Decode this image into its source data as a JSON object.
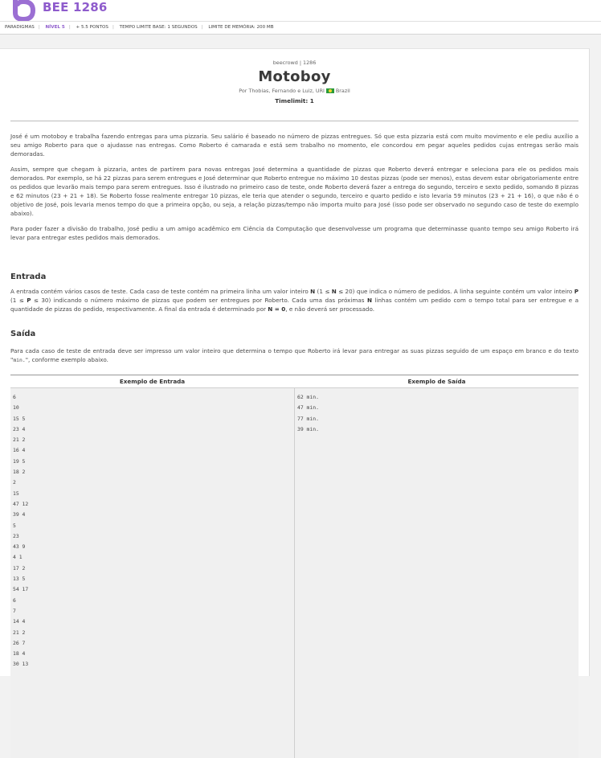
{
  "app": {
    "title": "BEE 1286",
    "brand_color": "#8e5bcc"
  },
  "meta": {
    "items": [
      "PARADIGMAS",
      "NÍVEL 5",
      "+ 5.5 PONTOS",
      "TEMPO LIMITE BASE: 1 SEGUNDOS",
      "LIMITE DE MEMÓRIA: 200 MB"
    ]
  },
  "problem": {
    "crumb": "beecrowd | 1286",
    "title": "Motoboy",
    "author": "Por Thobias, Fernando e Luiz, URI",
    "country": "Brazil",
    "timelimit": "Timelimit: 1"
  },
  "description": {
    "p1": "José é um motoboy e trabalha fazendo entregas para uma pizzaria. Seu salário é baseado no número de pizzas entregues. Só que esta pizzaria está com muito movimento e ele pediu auxílio a seu amigo Roberto para que o ajudasse nas entregas. Como Roberto é camarada e está sem trabalho no momento, ele concordou em pegar aqueles pedidos cujas entregas serão mais demoradas.",
    "p2": "Assim, sempre que chegam à pizzaria, antes de partirem para novas entregas José determina a quantidade de pizzas que Roberto deverá entregar e seleciona para ele os pedidos mais demorados. Por exemplo, se há 22 pizzas para serem entregues e José determinar que Roberto entregue no máximo 10 destas pizzas (pode ser menos), estas devem estar obrigatoriamente entre os pedidos que levarão mais tempo para serem entregues. Isso é ilustrado no primeiro caso de teste, onde Roberto deverá fazer a entrega do segundo, terceiro e sexto pedido, somando 8 pizzas e 62 minutos (23 + 21 + 18). Se Roberto fosse realmente entregar 10 pizzas, ele teria que atender o segundo, terceiro e quarto pedido e isto levaria 59 minutos (23 + 21 + 16), o que não é o objetivo de José, pois levaria menos tempo do que a primeira opção, ou seja, a relação pizzas/tempo não importa muito para José (isso pode ser observado no segundo caso de teste do exemplo abaixo).",
    "p3": "Para poder fazer a divisão do trabalho, José pediu a um amigo acadêmico em Ciência da Computação que desenvolvesse um programa que determinasse quanto tempo seu amigo Roberto irá levar para entregar estes pedidos mais demorados."
  },
  "input_section": {
    "heading": "Entrada",
    "t1": "A entrada contém vários casos de teste. Cada caso de teste contém na primeira linha um valor inteiro ",
    "b1": "N",
    "t2": " (1 ≤ ",
    "b2": "N",
    "t3": " ≤ 20) que indica o número de pedidos. A linha seguinte contém um valor inteiro ",
    "b3": "P",
    "t4": " (1 ≤ ",
    "b4": "P",
    "t5": " ≤ 30) indicando o número máximo de pizzas que podem ser entregues por Roberto. Cada uma das próximas ",
    "b5": "N",
    "t6": " linhas contém um pedido com o tempo total para ser entregue e a quantidade de pizzas do pedido, respectivamente. A final da entrada é determinado por ",
    "b6": "N = 0",
    "t7": ", e não deverá ser processado."
  },
  "output_section": {
    "heading": "Saída",
    "t1": "Para cada caso de teste de entrada deve ser impresso um valor inteiro que determina o tempo que Roberto irá levar para entregar as suas pizzas seguido de um espaço em branco e do texto \"",
    "code": "min.",
    "t2": "\", conforme exemplo abaixo."
  },
  "examples": {
    "input_header": "Exemplo de Entrada",
    "output_header": "Exemplo de Saída",
    "input": "6\n10\n15 5\n23 4\n21 2\n16 4\n19 5\n18 2\n2\n15\n47 12\n39 4\n5\n23\n43 9\n4 1\n17 2\n13 5\n54 17\n6\n7\n14 4\n21 2\n26 7\n18 4\n30 13",
    "output": "62 min.\n47 min.\n77 min.\n39 min."
  },
  "icons": {
    "logo": "beecrowd-logo",
    "expand": "fullscreen-icon",
    "flag": "brazil-flag-icon"
  }
}
